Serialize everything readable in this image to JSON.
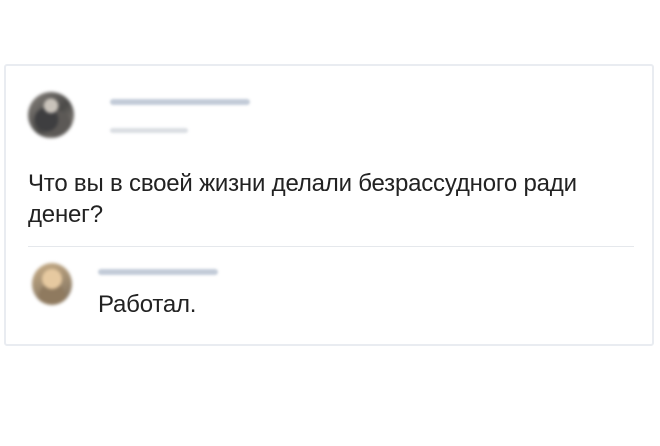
{
  "post": {
    "author_avatar": "avatar-image",
    "text": "Что вы в своей жизни делали безрассудного ради денег?"
  },
  "comment": {
    "commenter_avatar": "avatar-image",
    "text": "Работал."
  },
  "colors": {
    "card_border": "#e9ecf1",
    "text": "#222222",
    "blurred_name": "#b9c3d2",
    "divider": "#e5e8ec"
  }
}
